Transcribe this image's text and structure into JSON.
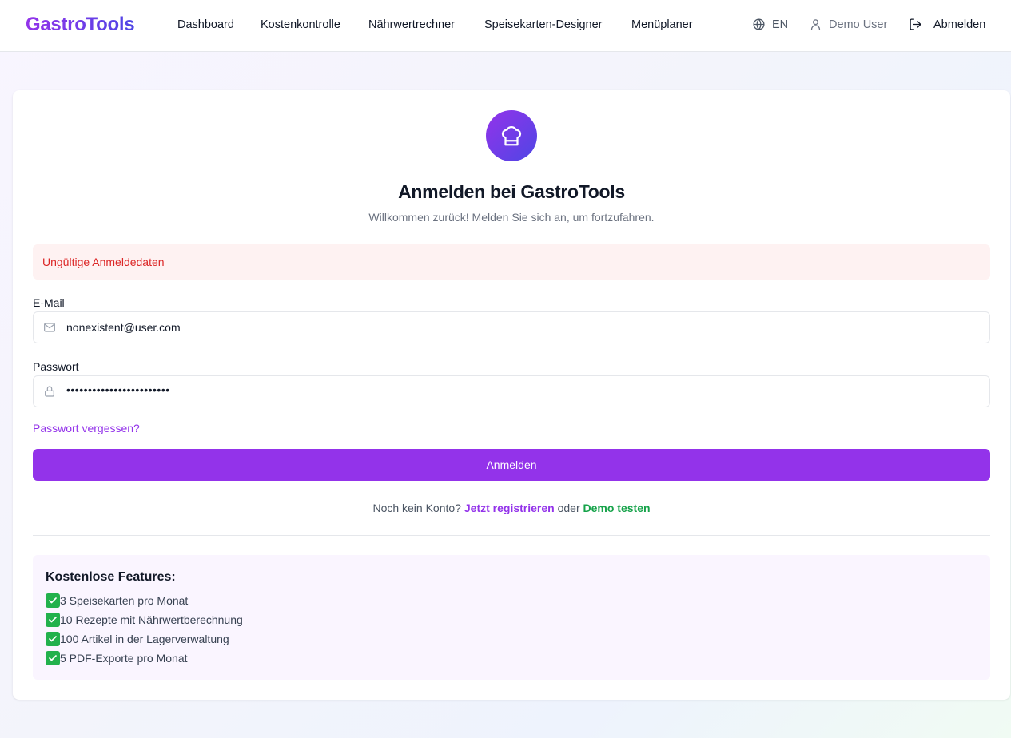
{
  "nav": {
    "brand": "GastroTools",
    "links": [
      "Dashboard",
      "Kostenkontrolle",
      "Nährwertrechner",
      "Speisekarten-Designer",
      "Menüplaner"
    ],
    "language": "EN",
    "user": "Demo User",
    "logout": "Abmelden"
  },
  "login": {
    "icon": "chef-hat-icon",
    "title": "Anmelden bei GastroTools",
    "subtitle": "Willkommen zurück! Melden Sie sich an, um fortzufahren.",
    "error": "Ungültige Anmeldedaten",
    "email_label": "E-Mail",
    "email_value": "nonexistent@user.com",
    "password_label": "Passwort",
    "password_value": "••••••••••••••••••••••••",
    "forgot": "Passwort vergessen?",
    "submit": "Anmelden",
    "no_account": "Noch kein Konto?",
    "register": "Jetzt registrieren",
    "or": "oder",
    "demo": "Demo testen"
  },
  "features": {
    "title": "Kostenlose Features:",
    "items": [
      "3 Speisekarten pro Monat",
      "10 Rezepte mit Nährwertberechnung",
      "100 Artikel in der Lagerverwaltung",
      "5 PDF-Exporte pro Monat"
    ]
  },
  "colors": {
    "primary": "#9333ea",
    "indigo": "#4f46e5",
    "error": "#dc2626",
    "success": "#16a34a"
  }
}
